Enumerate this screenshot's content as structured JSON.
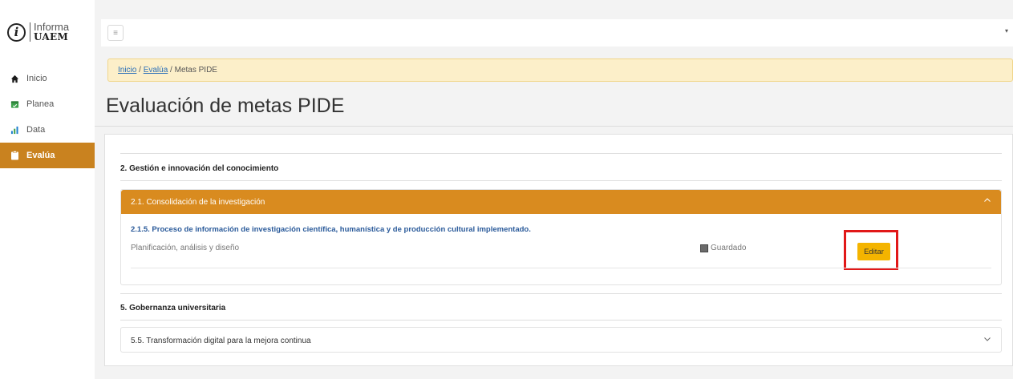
{
  "logo": {
    "line1": "Informa",
    "line2": "UAEM",
    "glyph": "i"
  },
  "sidebar": {
    "items": [
      {
        "label": "Inicio",
        "icon": "home-icon",
        "color": "#1a1a1a"
      },
      {
        "label": "Planea",
        "icon": "planea-icon",
        "color": "#3ca04a"
      },
      {
        "label": "Data",
        "icon": "chart-bars-icon",
        "color": "#1e7fd0"
      },
      {
        "label": "Evalúa",
        "icon": "clipboard-icon",
        "color": "#ffffff",
        "active": true
      }
    ]
  },
  "topbar": {
    "menu_glyph": "≡",
    "caret": "▾"
  },
  "breadcrumb": {
    "home": "Inicio",
    "sep1": " / ",
    "evalua": "Evalúa",
    "sep2": " / ",
    "current": "Metas PIDE"
  },
  "page": {
    "title": "Evaluación de metas PIDE"
  },
  "sections": [
    {
      "title": "2. Gestión e innovación del conocimiento",
      "accordion": {
        "label": "2.1. Consolidación de la investigación",
        "chevron": "︿",
        "goal_title": "2.1.5. Proceso de información de investigación científica, humanística y de producción cultural implementado.",
        "goal_subtitle": "Planificación, análisis y diseño",
        "status": "Guardado",
        "edit_label": "Editar"
      }
    },
    {
      "title": "5. Gobernanza universitaria",
      "accordion": {
        "label": "5.5. Transformación digital para la mejora continua",
        "chevron": "﹀"
      }
    }
  ],
  "colors": {
    "accent": "#d98b1f",
    "sidebar_active": "#c9821f",
    "edit_button": "#f4b400",
    "highlight": "#e11818",
    "breadcrumb_bg": "#fcefc9"
  }
}
